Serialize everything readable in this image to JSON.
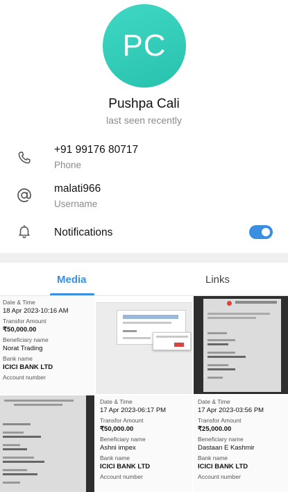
{
  "profile": {
    "initials": "PC",
    "name": "Pushpa Cali",
    "status": "last seen recently"
  },
  "info": {
    "phone": {
      "value": "+91 99176 80717",
      "label": "Phone"
    },
    "username": {
      "value": "malati966",
      "label": "Username"
    },
    "notifications": {
      "label": "Notifications",
      "enabled": true
    }
  },
  "tabs": {
    "media": "Media",
    "links": "Links",
    "active": "Media"
  },
  "colors": {
    "accent": "#3a8fe0",
    "avatar": "#2ec8b3"
  },
  "media": {
    "receipt1": {
      "date_label": "Date & Time",
      "date": "18 Apr 2023-10:16 AM",
      "amount_label": "Transfor Amount",
      "amount": "₹50,000.00",
      "beneficiary_label": "Beneficiary name",
      "beneficiary": "Norat Trading",
      "bank_label": "Bank name",
      "bank": "ICICI BANK LTD",
      "account_label": "Account number"
    },
    "receipt2": {
      "date_label": "Date & Time",
      "date": "17 Apr 2023-06:17 PM",
      "amount_label": "Transfor Amount",
      "amount": "₹50,000.00",
      "beneficiary_label": "Beneficiary name",
      "beneficiary": "Ashni impex",
      "bank_label": "Bank name",
      "bank": "ICICI BANK LTD",
      "account_label": "Account number"
    },
    "receipt3": {
      "date_label": "Date & Time",
      "date": "17 Apr 2023-03:56 PM",
      "amount_label": "Transfor Amount",
      "amount": "₹25,000.00",
      "beneficiary_label": "Beneficiary name",
      "beneficiary": "Dastaan E Kashmir",
      "bank_label": "Bank name",
      "bank": "ICICI BANK LTD",
      "account_label": "Account number"
    }
  }
}
